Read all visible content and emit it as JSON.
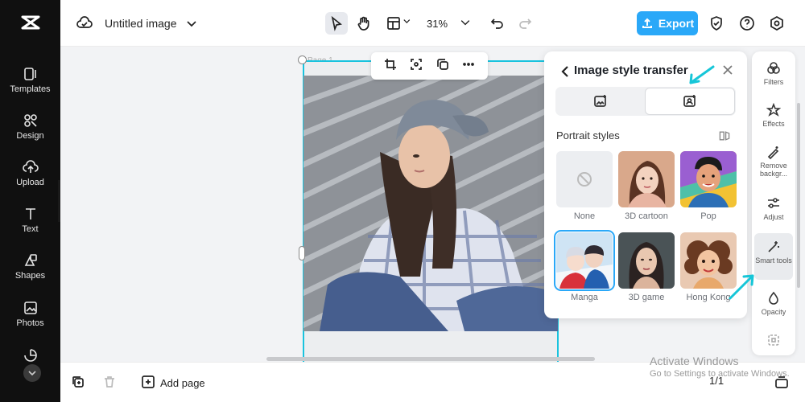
{
  "header": {
    "doc_title": "Untitled image",
    "zoom": "31%",
    "export_label": "Export"
  },
  "sidebar": {
    "items": [
      {
        "label": "Templates",
        "icon": "templates-icon"
      },
      {
        "label": "Design",
        "icon": "design-icon"
      },
      {
        "label": "Upload",
        "icon": "upload-icon"
      },
      {
        "label": "Text",
        "icon": "text-icon"
      },
      {
        "label": "Shapes",
        "icon": "shapes-icon"
      },
      {
        "label": "Photos",
        "icon": "photos-icon"
      }
    ]
  },
  "canvas": {
    "page_label": "Page 1"
  },
  "panel": {
    "title": "Image style transfer",
    "section_title": "Portrait styles",
    "styles": [
      {
        "label": "None"
      },
      {
        "label": "3D cartoon"
      },
      {
        "label": "Pop"
      },
      {
        "label": "Manga",
        "selected": true
      },
      {
        "label": "3D game"
      },
      {
        "label": "Hong Kong"
      }
    ]
  },
  "rail": {
    "items": [
      {
        "label": "Filters"
      },
      {
        "label": "Effects"
      },
      {
        "label": "Remove backgr..."
      },
      {
        "label": "Adjust"
      },
      {
        "label": "Smart tools",
        "active": true
      },
      {
        "label": "Opacity"
      }
    ]
  },
  "footer": {
    "add_page_label": "Add page",
    "page_counter": "1/1"
  },
  "watermark": {
    "line1": "Activate Windows",
    "line2": "Go to Settings to activate Windows."
  },
  "colors": {
    "accent": "#2aa8f8",
    "annotation_arrow": "#16c6d8",
    "selection": "#19c3de"
  }
}
